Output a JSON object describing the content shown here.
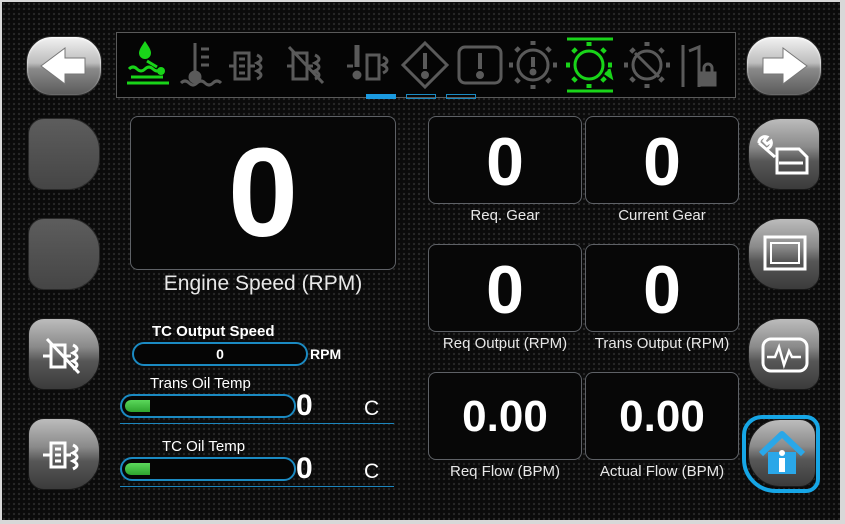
{
  "toolbar": {
    "icons": [
      {
        "name": "coolant-level-icon",
        "active": true
      },
      {
        "name": "coolant-temp-icon",
        "active": false
      },
      {
        "name": "engine-filter-icon",
        "active": false
      },
      {
        "name": "engine-filter-disabled-icon",
        "active": false
      },
      {
        "name": "engine-warning-icon",
        "active": false
      },
      {
        "name": "diamond-warning-icon",
        "active": false
      },
      {
        "name": "engine-alert-icon",
        "active": false
      },
      {
        "name": "gear-warning-icon",
        "active": false
      },
      {
        "name": "transmission-gear-icon",
        "active": true
      },
      {
        "name": "gear-disabled-icon",
        "active": false
      },
      {
        "name": "door-lock-icon",
        "active": false
      }
    ],
    "page_indicator": {
      "pages": 3,
      "current": 1
    }
  },
  "engine": {
    "speed_value": "0",
    "speed_label": "Engine Speed (RPM)"
  },
  "tc_output": {
    "label": "TC Output Speed",
    "value": "0",
    "unit": "RPM"
  },
  "trans_oil_temp": {
    "label": "Trans Oil Temp",
    "value": "0",
    "unit": "C",
    "level": 0.15
  },
  "tc_oil_temp": {
    "label": "TC Oil Temp",
    "value": "0",
    "unit": "C",
    "level": 0.15
  },
  "gauges": {
    "req_gear": {
      "value": "0",
      "label": "Req. Gear"
    },
    "current_gear": {
      "value": "0",
      "label": "Current Gear"
    },
    "req_output": {
      "value": "0",
      "label": "Req Output (RPM)"
    },
    "trans_output": {
      "value": "0",
      "label": "Trans Output (RPM)"
    },
    "req_flow": {
      "value": "0.00",
      "label": "Req Flow (BPM)"
    },
    "actual_flow": {
      "value": "0.00",
      "label": "Actual Flow (BPM)"
    }
  },
  "colors": {
    "active_icon": "#19d419",
    "inactive_icon": "#5a5a5a",
    "accent": "#1b8ac2",
    "home_ring": "#16a6e6"
  }
}
